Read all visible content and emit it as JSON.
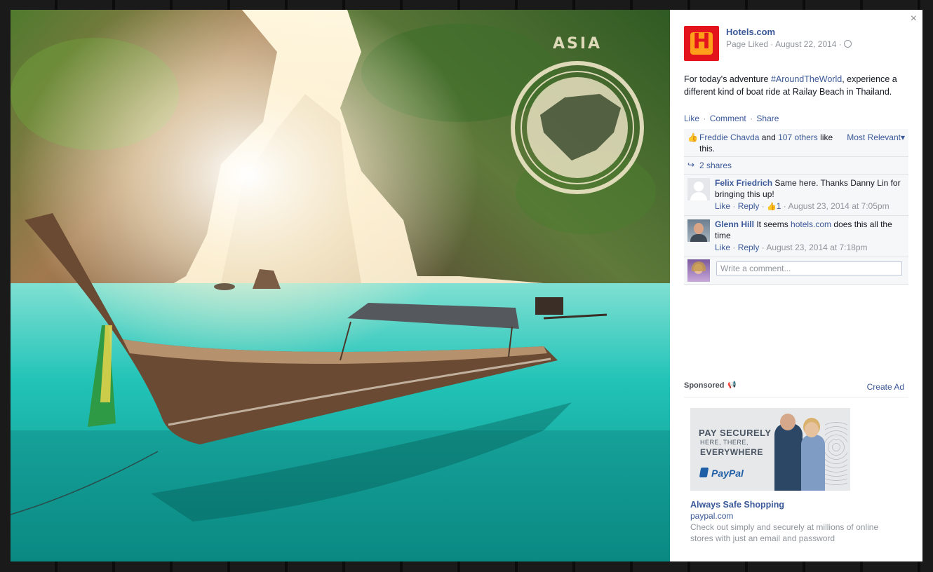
{
  "photo": {
    "stamp_text": "ASIA"
  },
  "post": {
    "close_label": "×",
    "page_name": "Hotels.com",
    "logo_letter": "H",
    "meta_prefix": "Page Liked · ",
    "date": "August 22, 2014",
    "meta_suffix": " ·",
    "text_before": "For today's adventure ",
    "hashtag": "#AroundTheWorld",
    "text_after": ", experience a different kind of boat ride at Railay Beach in Thailand.",
    "actions": {
      "like": "Like",
      "comment": "Comment",
      "share": "Share",
      "sep": "·"
    }
  },
  "ufi": {
    "likes": {
      "name": "Freddie Chavda",
      "and": " and ",
      "others": "107 others",
      "suffix": " like this."
    },
    "sort_label": "Most Relevant▾",
    "shares": "2 shares",
    "comments": [
      {
        "author": "Felix Friedrich",
        "text": " Same here. Thanks Danny Lin for bringing this up!",
        "like": "Like",
        "reply": "Reply",
        "like_count": "1",
        "time": "August 23, 2014 at 7:05pm"
      },
      {
        "author": "Glenn Hill",
        "text_before": " It seems ",
        "link": "hotels.com",
        "text_after": " does this all the time",
        "like": "Like",
        "reply": "Reply",
        "time": "August 23, 2014 at 7:18pm"
      }
    ],
    "write_placeholder": "Write a comment..."
  },
  "sponsored": {
    "label": "Sponsored",
    "create_ad": "Create Ad",
    "ad": {
      "headline1": "PAY SECURELY",
      "headline2": "HERE, THERE,",
      "headline3": "EVERYWHERE",
      "brand": "PayPal",
      "title": "Always Safe Shopping",
      "domain": "paypal.com",
      "description": "Check out simply and securely at millions of online stores with just an email and password"
    }
  },
  "colors": {
    "link": "#3b5998",
    "muted": "#90949c",
    "brand_red": "#e3141b",
    "water": "#1fbfb6"
  }
}
